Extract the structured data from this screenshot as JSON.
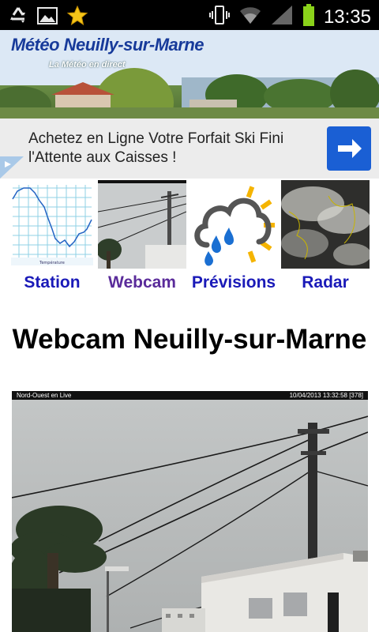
{
  "status_bar": {
    "time": "13:35",
    "icons": [
      "recycle-icon",
      "image-icon",
      "star-icon",
      "vibrate-icon",
      "wifi-icon",
      "signal-icon",
      "battery-icon"
    ]
  },
  "banner": {
    "title": "Météo Neuilly-sur-Marne",
    "subtitle": "La Météo en direct"
  },
  "ad": {
    "text": "Achetez en Ligne Votre Forfait Ski Fini l'Attente aux Caisses !",
    "button_icon": "arrow-right-icon",
    "accent": "#1a5fd4"
  },
  "nav": [
    {
      "label": "Station",
      "icon": "station-chart-thumbnail"
    },
    {
      "label": "Webcam",
      "icon": "webcam-thumbnail"
    },
    {
      "label": "Prévisions",
      "icon": "weather-forecast-icon"
    },
    {
      "label": "Radar",
      "icon": "radar-satellite-thumbnail"
    }
  ],
  "page": {
    "title": "Webcam Neuilly-sur-Marne"
  },
  "webcam": {
    "overlay_left": "Nord-Ouest en Live",
    "overlay_right": "10/04/2013 13:32:58  [378]"
  },
  "colors": {
    "link": "#1a1ab8",
    "link_visited": "#5a2b9a",
    "banner_title": "#173a9a"
  }
}
